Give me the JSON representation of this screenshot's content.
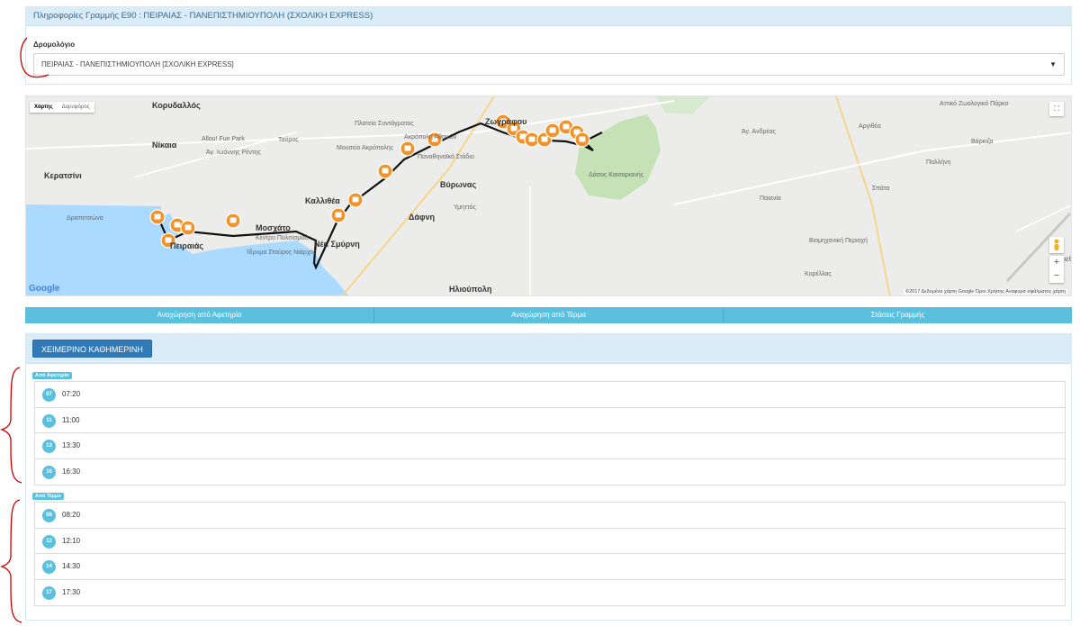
{
  "line_panel": {
    "title": "Πληροφορίες Γραμμής Ε90 : ΠΕΙΡΑΙΑΣ - ΠΑΝΕΠΙΣΤΗΜΙΟΥΠΟΛΗ (ΣΧΟΛΙΚΗ EXPRESS)",
    "route_label": "Δρομολόγιο",
    "route_value": "ΠΕΙΡΑΙΑΣ - ΠΑΝΕΠΙΣΤΗΜΙΟΥΠΟΛΗ [ΣΧΟΛΙΚΗ EXPRESS]"
  },
  "map": {
    "type_map": "Χάρτης",
    "type_satellite": "Δορυφόρος",
    "google": "Google",
    "attribution": "©2017 Δεδομένα χάρτη Google   Όροι Χρήσης   Αναφορά σφάλματος χάρτη",
    "places": [
      "Κορυδαλλός",
      "Νίκαια",
      "Κερατσίνι",
      "Δραπετσώνα",
      "Πειραιάς",
      "Μοσχάτο",
      "Καλλιθέα",
      "Ταύρος",
      "Νέα Σμύρνη",
      "Δάφνη",
      "Βύρωνας",
      "Ζωγράφου",
      "Ηλιούπολη",
      "Παιανία",
      "Αργιθέα",
      "Σπάτα",
      "Παλλήνη",
      "Άγ. Ιωάννης Ρέντης",
      "Πλατεία Συντάγματος",
      "Ακρόπολη Αθηνών",
      "Μουσείο Ακρόπολης",
      "Παναθηναϊκό Στάδιο",
      "Allou! Fun Park",
      "Ίδρυμα Σταύρος Νιάρχος",
      "Άγ. Ανδρέας",
      "Βιομηχανική Περιοχή",
      "Κορέλλας",
      "Υμηττός",
      "Αττικό Ζωολογικό Πάρκο",
      "Κέντρο Πολιτισμού",
      "Δάσος Καισαριανής",
      "Βάρκιζα",
      "Διεθνής Αερολιμένας Αθηνών"
    ],
    "stop_count": 19
  },
  "tabs": [
    "Αναχώρηση από Αφετηρία",
    "Αναχώρηση από Τέρμα",
    "Στάσεις Γραμμής"
  ],
  "schedule": {
    "button": "ΧΕΙΜΕΡΙΝΟ ΚΑΘΗΜΕΡΙΝΗ",
    "groups": [
      {
        "label": "Από Αφετηρία",
        "rows": [
          {
            "hour": "07",
            "time": "07:20"
          },
          {
            "hour": "11",
            "time": "11:00"
          },
          {
            "hour": "13",
            "time": "13:30"
          },
          {
            "hour": "16",
            "time": "16:30"
          }
        ]
      },
      {
        "label": "Από Τέρμα",
        "rows": [
          {
            "hour": "08",
            "time": "08:20"
          },
          {
            "hour": "12",
            "time": "12:10"
          },
          {
            "hour": "14",
            "time": "14:30"
          },
          {
            "hour": "17",
            "time": "17:30"
          }
        ]
      }
    ]
  },
  "colors": {
    "header_bg": "#d9ecf7",
    "tab_bg": "#5bc0de",
    "button_bg": "#3279b7",
    "route_line": "#111111",
    "stop_marker": "#f0932b",
    "annotation": "#cc0000"
  }
}
